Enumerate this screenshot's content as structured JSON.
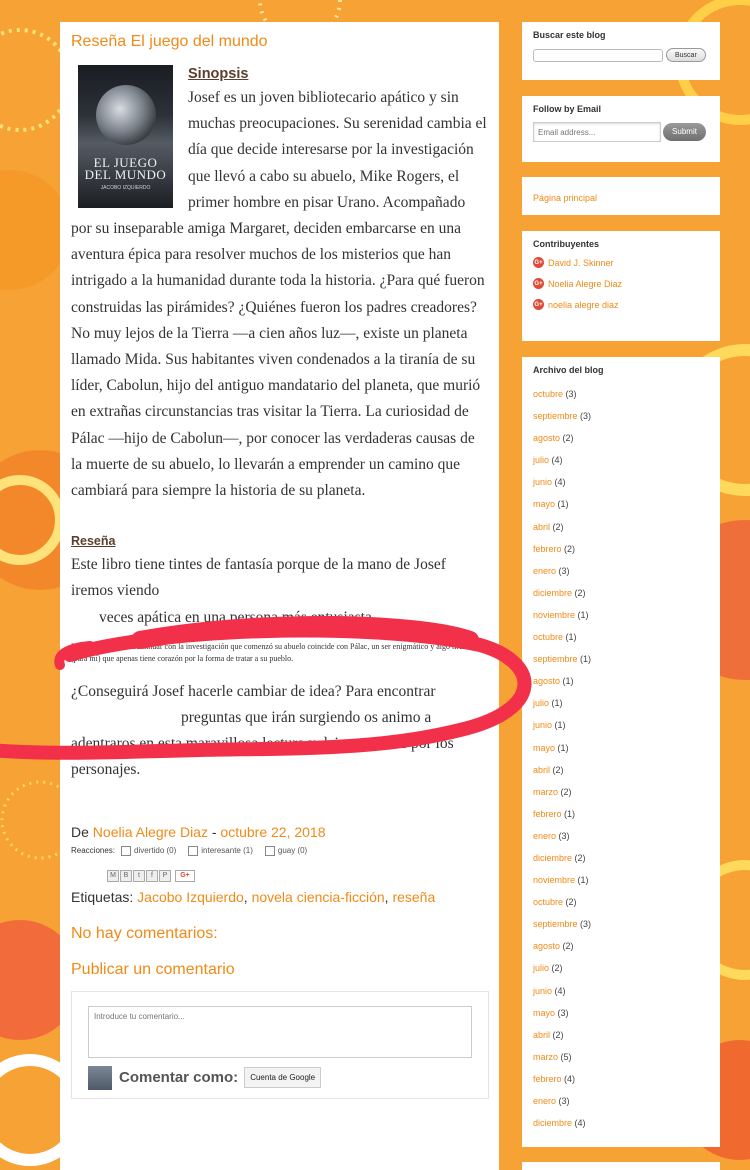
{
  "post": {
    "title": "Reseña El juego del mundo",
    "cover": {
      "title_line1": "EL JUEGO",
      "title_line2": "DEL MUNDO",
      "author": "JACOBO IZQUIERDO"
    },
    "sinopsis_heading": "Sinopsis",
    "sinopsis_text": "Josef es un joven bibliotecario apático y sin muchas preocupaciones. Su serenidad cambia el día que decide interesarse por la investigación que llevó a cabo su abuelo, Mike Rogers, el primer hombre en pisar Urano. Acompañado por su inseparable amiga Margaret, deciden embarcarse en una aventura épica para resolver muchos de los misterios que han intrigado a la humanidad durante toda la historia. ¿Para qué fueron construidas las pirámides? ¿Quiénes fueron los padres creadores? No muy lejos de la Tierra —a cien años luz—, existe un planeta llamado Mida. Sus habitantes viven condenados a la tiranía de su líder, Cabolun, hijo del antiguo mandatario del planeta, que murió en extrañas circunstancias tras visitar la Tierra. La curiosidad de Pálac —hijo de Cabolun—, por conocer las verdaderas causas de la muerte de su abuelo, lo llevarán a emprender un camino que cambiará para siempre la historia de su planeta.",
    "resena_heading": "Reseña",
    "resena_p1": "Este libro tiene tintes de fantasía porque de la mano de Josef iremos viendo",
    "resena_p1b": "veces apática en una persona más entusiasta.",
    "resena_small": "En  su camino para continuar con la investigación que comenzó su abuelo coincide con Pálac, un ser enigmático y algo tirano (para mí) que apenas tiene corazón por la forma de tratar a su pueblo.",
    "resena_p2a": "¿Conseguirá Josef hacerle cambiar de idea? Para encontrar",
    "resena_p2b": "preguntas que irán surgiendo os animo a",
    "resena_p2c": "adentraros en esta maravillosa lectura y dejaros influir por los personajes.",
    "by_label": "De",
    "author": "Noelia Alegre Diaz",
    "date_sep": " - ",
    "date": "octubre 22, 2018",
    "reactions_label": "Reacciones:",
    "reactions": [
      {
        "label": "divertido (0)"
      },
      {
        "label": "interesante (1)"
      },
      {
        "label": "guay (0)"
      }
    ],
    "share_icons": [
      "email-icon",
      "blog-icon",
      "twitter-icon",
      "facebook-icon",
      "pinterest-icon"
    ],
    "gplus": "G+",
    "labels_label": "Etiquetas:",
    "labels": [
      "Jacobo Izquierdo",
      "novela ciencia-ficción",
      "reseña"
    ],
    "no_comments": "No hay comentarios:",
    "post_comment": "Publicar un comentario",
    "comment_placeholder": "Introduce tu comentario...",
    "comment_as": "Comentar como:",
    "account_button": "Cuenta de Google"
  },
  "sidebar": {
    "search": {
      "title": "Buscar este blog",
      "button": "Buscar"
    },
    "follow": {
      "title": "Follow by Email",
      "placeholder": "Email address...",
      "button": "Submit"
    },
    "home_link": "Página principal",
    "contributors": {
      "title": "Contribuyentes",
      "items": [
        "David J. Skinner",
        "Noelia Alegre Diaz",
        "noelia alegre diaz"
      ]
    },
    "archive": {
      "title": "Archivo del blog",
      "items": [
        {
          "month": "octubre",
          "count": "(3)"
        },
        {
          "month": "septiembre",
          "count": "(3)"
        },
        {
          "month": "agosto",
          "count": "(2)"
        },
        {
          "month": "julio",
          "count": "(4)"
        },
        {
          "month": "junio",
          "count": "(4)"
        },
        {
          "month": "mayo",
          "count": "(1)"
        },
        {
          "month": "abril",
          "count": "(2)"
        },
        {
          "month": "febrero",
          "count": "(2)"
        },
        {
          "month": "enero",
          "count": "(3)"
        },
        {
          "month": "diciembre",
          "count": "(2)"
        },
        {
          "month": "noviembre",
          "count": "(1)"
        },
        {
          "month": "octubre",
          "count": "(1)"
        },
        {
          "month": "septiembre",
          "count": "(1)"
        },
        {
          "month": "agosto",
          "count": "(1)"
        },
        {
          "month": "julio",
          "count": "(1)"
        },
        {
          "month": "junio",
          "count": "(1)"
        },
        {
          "month": "mayo",
          "count": "(1)"
        },
        {
          "month": "abril",
          "count": "(2)"
        },
        {
          "month": "marzo",
          "count": "(2)"
        },
        {
          "month": "febrero",
          "count": "(1)"
        },
        {
          "month": "enero",
          "count": "(3)"
        },
        {
          "month": "diciembre",
          "count": "(2)"
        },
        {
          "month": "noviembre",
          "count": "(1)"
        },
        {
          "month": "octubre",
          "count": "(2)"
        },
        {
          "month": "septiembre",
          "count": "(3)"
        },
        {
          "month": "agosto",
          "count": "(2)"
        },
        {
          "month": "julio",
          "count": "(2)"
        },
        {
          "month": "junio",
          "count": "(4)"
        },
        {
          "month": "mayo",
          "count": "(3)"
        },
        {
          "month": "abril",
          "count": "(2)"
        },
        {
          "month": "marzo",
          "count": "(5)"
        },
        {
          "month": "febrero",
          "count": "(4)"
        },
        {
          "month": "enero",
          "count": "(3)"
        },
        {
          "month": "diciembre",
          "count": "(4)"
        }
      ]
    }
  },
  "colors": {
    "accent": "#f08a17",
    "background": "#f7a234",
    "marker": "#f2304a"
  }
}
